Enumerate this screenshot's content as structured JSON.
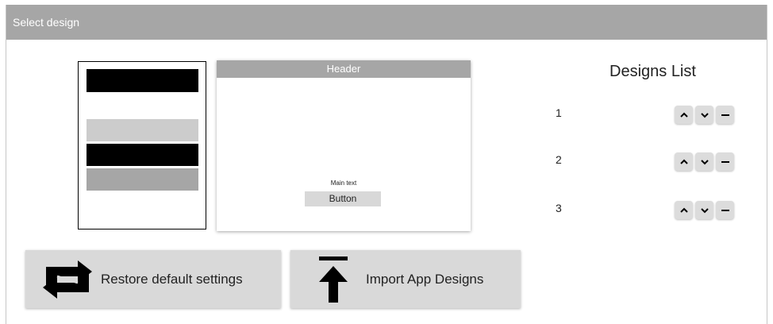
{
  "window": {
    "title": "Select design"
  },
  "preview": {
    "header": "Header",
    "main_text": "Main text",
    "button_label": "Button"
  },
  "designs_list": {
    "title": "Designs List",
    "items": [
      {
        "number": "1"
      },
      {
        "number": "2"
      },
      {
        "number": "3"
      }
    ],
    "icons": {
      "up": "chevron-up-icon",
      "down": "chevron-down-icon",
      "remove": "minus-icon"
    }
  },
  "actions": {
    "restore_label": "Restore default settings",
    "restore_icon": "swap-arrows-icon",
    "import_label": "Import App Designs",
    "import_icon": "upload-arrow-icon"
  },
  "colors": {
    "title_bar": "#a6a6a6",
    "button_bg": "#d9d9d9",
    "thumb_dark": "#000000",
    "thumb_light": "#cccccc",
    "thumb_mid": "#a6a6a6"
  }
}
